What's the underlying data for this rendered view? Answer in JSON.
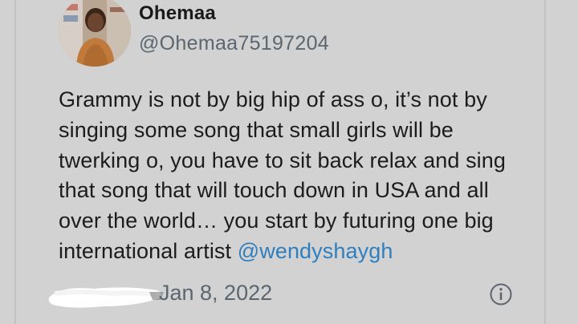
{
  "tweet": {
    "author": {
      "name": "Ohemaa",
      "handle": "@Ohemaa75197204"
    },
    "text_lines": [
      "Grammy is not by big hip of ass o, it’s not by",
      "singing some song that small girls will be",
      "twerking o, you have to sit back relax and sing",
      "that song that will touch down in USA and all",
      "over the world… you start by futuring one big",
      "international artist "
    ],
    "mention": "@wendyshaygh",
    "date": "Jan 8, 2022"
  },
  "icons": {
    "avatar": "profile-photo",
    "info": "info-circle-icon"
  },
  "colors": {
    "background": "#d2d2d2",
    "text": "#1c1c1c",
    "secondary_text": "#5b6670",
    "mention": "#2f7fbf"
  }
}
